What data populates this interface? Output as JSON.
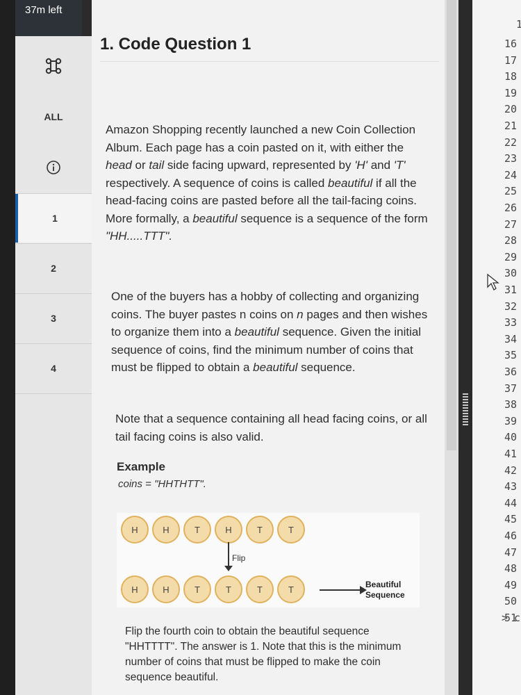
{
  "timer": "37m left",
  "sidebar": {
    "cmd_icon": "command-icon",
    "all_label": "ALL",
    "info_icon": "info-icon",
    "questions": [
      "1",
      "2",
      "3",
      "4"
    ],
    "active": "1"
  },
  "question": {
    "title": "1. Code Question 1",
    "p1": [
      {
        "t": "Amazon Shopping recently launched a new Coin "
      },
      {
        "t": "Collection Album. Each page has a coin pasted on it, "
      },
      {
        "t": "with either the "
      },
      {
        "t": "head",
        "i": true
      },
      {
        "t": " or "
      },
      {
        "t": "tail",
        "i": true
      },
      {
        "t": " side facing upward, "
      },
      {
        "t": "represented by "
      },
      {
        "t": "'H'",
        "i": true
      },
      {
        "t": " and "
      },
      {
        "t": "'T'",
        "i": true
      },
      {
        "t": " respectively. A sequence of "
      },
      {
        "t": "coins is called "
      },
      {
        "t": "beautiful",
        "i": true
      },
      {
        "t": " if all the head-facing coins are "
      },
      {
        "t": "pasted before all the tail-facing coins. More formally, a "
      },
      {
        "t": "beautiful",
        "i": true
      },
      {
        "t": " sequence is a sequence of the form "
      },
      {
        "t": "\"HH.....TTT\".",
        "i": true
      }
    ],
    "p2": [
      {
        "t": "One of the buyers has a hobby of collecting and "
      },
      {
        "t": "organizing coins. The buyer pastes n coins on "
      },
      {
        "t": "n",
        "i": true
      },
      {
        "t": " pages "
      },
      {
        "t": "and then wishes to organize them into a "
      },
      {
        "t": "beautiful",
        "i": true
      },
      {
        "t": " "
      },
      {
        "t": "sequence. Given the initial sequence of coins, find the "
      },
      {
        "t": "minimum number of coins that must be flipped to "
      },
      {
        "t": "obtain a "
      },
      {
        "t": "beautiful",
        "i": true
      },
      {
        "t": " sequence."
      }
    ],
    "p3": "Note that a sequence containing all head facing coins, or all tail facing coins is also valid.",
    "example_heading": "Example",
    "example_value": "coins = \"HHTHTT\".",
    "diagram": {
      "top_row": [
        "H",
        "H",
        "T",
        "H",
        "T",
        "T"
      ],
      "flip_label": "Flip",
      "bottom_row": [
        "H",
        "H",
        "T",
        "T",
        "T",
        "T"
      ],
      "result_label_1": "Beautiful",
      "result_label_2": "Sequence"
    },
    "p4": "Flip the fourth coin to obtain the beautiful sequence \"HHTTTT\". The answer is 1. Note that this is the minimum number of coins that must be flipped to make the coin sequence beautiful."
  },
  "editor": {
    "top_partial": "1",
    "line_numbers": [
      "16",
      "17",
      "18",
      "19",
      "20",
      "21",
      "22",
      "23",
      "24",
      "25",
      "26",
      "27",
      "28",
      "29",
      "30",
      "31",
      "32",
      "33",
      "34",
      "35",
      "36",
      "37",
      "38",
      "39",
      "40",
      "41",
      "42",
      "43",
      "44",
      "45",
      "46",
      "47",
      "48",
      "49",
      "50",
      "51"
    ],
    "last_line_suffix": "> c"
  }
}
